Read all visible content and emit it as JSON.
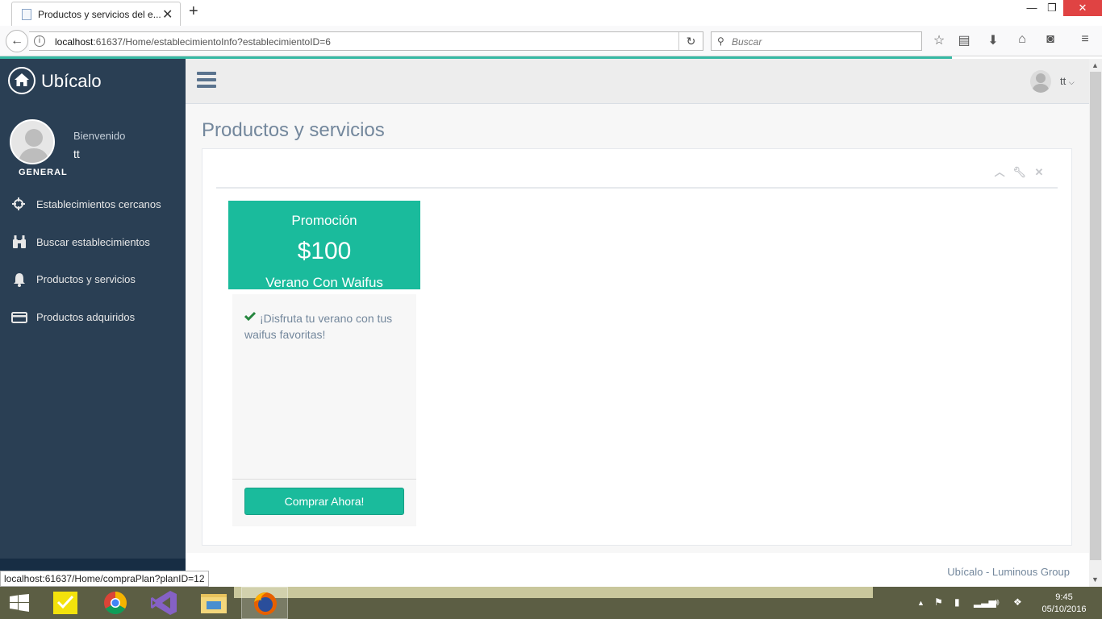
{
  "browser": {
    "tab_title": "Productos y servicios del e...",
    "url_host": "localhost",
    "url_rest": ":61637/Home/establecimientoInfo?establecimientoID=6",
    "search_placeholder": "Buscar",
    "status_url": "localhost:61637/Home/compraPlan?planID=12"
  },
  "sidebar": {
    "brand": "Ubícalo",
    "welcome": "Bienvenido",
    "username": "tt",
    "section": "GENERAL",
    "items": [
      {
        "label": "Establecimientos cercanos",
        "icon": "crosshairs-icon"
      },
      {
        "label": "Buscar establecimientos",
        "icon": "binoculars-icon"
      },
      {
        "label": "Productos y servicios",
        "icon": "bell-icon"
      },
      {
        "label": "Productos adquiridos",
        "icon": "credit-card-icon"
      }
    ]
  },
  "topnav": {
    "user": "tt"
  },
  "page": {
    "title": "Productos y servicios"
  },
  "plan": {
    "type": "Promoción",
    "price": "$100",
    "name": "Verano Con Waifus",
    "description": "¡Disfruta tu verano con tus waifus favoritas!",
    "buy_label": "Comprar Ahora!"
  },
  "footer": {
    "text": "Ubícalo - Luminous Group"
  },
  "taskbar": {
    "time": "9:45",
    "date": "05/10/2016"
  },
  "colors": {
    "sidebar": "#2a3f54",
    "accent": "#1abb9c",
    "title": "#73879c"
  }
}
